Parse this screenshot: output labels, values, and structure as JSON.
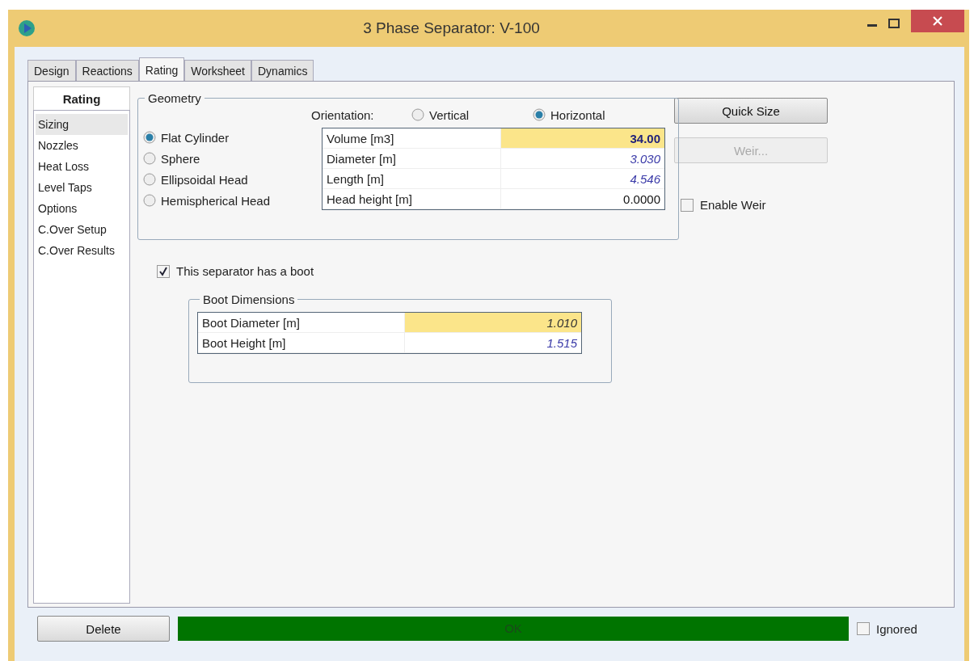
{
  "window": {
    "title": "3 Phase Separator: V-100"
  },
  "tabs": [
    {
      "label": "Design",
      "selected": false
    },
    {
      "label": "Reactions",
      "selected": false
    },
    {
      "label": "Rating",
      "selected": true
    },
    {
      "label": "Worksheet",
      "selected": false
    },
    {
      "label": "Dynamics",
      "selected": false
    }
  ],
  "sidebar": {
    "title": "Rating",
    "items": [
      {
        "label": "Sizing",
        "selected": true
      },
      {
        "label": "Nozzles",
        "selected": false
      },
      {
        "label": "Heat Loss",
        "selected": false
      },
      {
        "label": "Level Taps",
        "selected": false
      },
      {
        "label": "Options",
        "selected": false
      },
      {
        "label": "C.Over Setup",
        "selected": false
      },
      {
        "label": "C.Over Results",
        "selected": false
      }
    ]
  },
  "geometry": {
    "title": "Geometry",
    "shapes": [
      {
        "label": "Flat Cylinder",
        "selected": true
      },
      {
        "label": "Sphere",
        "selected": false
      },
      {
        "label": "Ellipsoidal Head",
        "selected": false
      },
      {
        "label": "Hemispherical Head",
        "selected": false
      }
    ],
    "orientation_label": "Orientation:",
    "orientations": [
      {
        "label": "Vertical",
        "selected": false
      },
      {
        "label": "Horizontal",
        "selected": true
      }
    ],
    "rows": [
      {
        "label": "Volume [m3]",
        "value": "34.00",
        "kind": "input",
        "highlighted": true
      },
      {
        "label": "Diameter [m]",
        "value": "3.030",
        "kind": "calculated",
        "highlighted": false
      },
      {
        "label": "Length [m]",
        "value": "4.546",
        "kind": "calculated",
        "highlighted": false
      },
      {
        "label": "Head height [m]",
        "value": "0.0000",
        "kind": "default",
        "highlighted": false
      }
    ]
  },
  "buttons": [
    {
      "label": "Quick Size",
      "disabled": false
    },
    {
      "label": "Weir...",
      "disabled": true
    }
  ],
  "enable_weir": {
    "label": "Enable Weir",
    "checked": false
  },
  "boot_checkbox": {
    "label": "This separator has a boot",
    "checked": true
  },
  "boot": {
    "title": "Boot Dimensions",
    "rows": [
      {
        "label": "Boot Diameter [m]",
        "value": "1.010",
        "kind": "specified",
        "highlighted": true
      },
      {
        "label": "Boot Height [m]",
        "value": "1.515",
        "kind": "calculated",
        "highlighted": false
      }
    ]
  },
  "footer": {
    "delete": "Delete",
    "status": {
      "text": "OK",
      "color": "#007400"
    },
    "ignored": {
      "label": "Ignored",
      "checked": false
    }
  }
}
